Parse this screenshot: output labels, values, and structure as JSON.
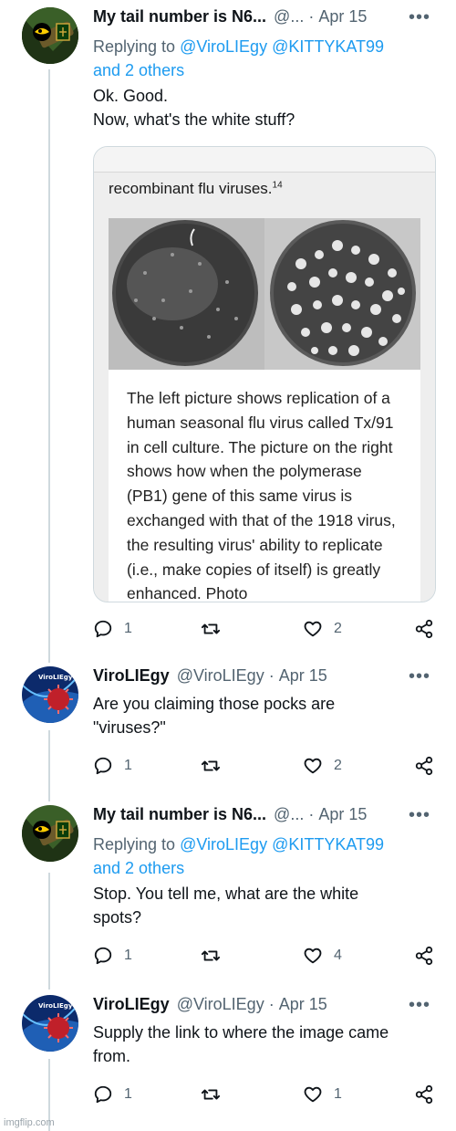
{
  "colors": {
    "link": "#1d9bf0",
    "muted": "#536471",
    "text": "#0f1419",
    "border": "#cfd9de"
  },
  "tweets": [
    {
      "name": "My tail number is N6...",
      "handle": "@...",
      "date": "Apr 15",
      "replying_prefix": "Replying to",
      "replying_users": "@ViroLIEgy @KITTYKAT99",
      "replying_others": "and 2 others",
      "text_lines": [
        "Ok. Good.",
        "Now, what's the white stuff?"
      ],
      "reply_count": "1",
      "retweet_count": "",
      "like_count": "2",
      "avatar_icon": "hawkeye-avatar-icon",
      "media": {
        "top_caption": "recombinant flu viruses.",
        "top_caption_sup": "14",
        "body": "The left picture shows replication of a human seasonal flu virus called Tx/91 in cell culture. The picture on the right shows how when the polymerase (PB1) gene of this same virus is exchanged with that of the 1918 virus, the resulting virus' ability to replicate (i.e., make copies of itself) is greatly enhanced. Photo"
      }
    },
    {
      "name": "ViroLIEgy",
      "handle": "@ViroLIEgy",
      "date": "Apr 15",
      "text_lines": [
        "Are you claiming those pocks are",
        "\"viruses?\""
      ],
      "reply_count": "1",
      "retweet_count": "",
      "like_count": "2",
      "avatar_icon": "virus-avatar-icon",
      "avatar_text": "ViroLIEgy"
    },
    {
      "name": "My tail number is N6...",
      "handle": "@...",
      "date": "Apr 15",
      "replying_prefix": "Replying to",
      "replying_users": "@ViroLIEgy @KITTYKAT99",
      "replying_others": "and 2 others",
      "text_lines": [
        "Stop. You tell me, what are the white",
        "spots?"
      ],
      "reply_count": "1",
      "retweet_count": "",
      "like_count": "4",
      "avatar_icon": "hawkeye-avatar-icon"
    },
    {
      "name": "ViroLIEgy",
      "handle": "@ViroLIEgy",
      "date": "Apr 15",
      "text_lines": [
        "Supply the link to where the image came",
        "from."
      ],
      "reply_count": "1",
      "retweet_count": "",
      "like_count": "1",
      "avatar_icon": "virus-avatar-icon",
      "avatar_text": "ViroLIEgy"
    }
  ],
  "watermark": "imgflip.com"
}
